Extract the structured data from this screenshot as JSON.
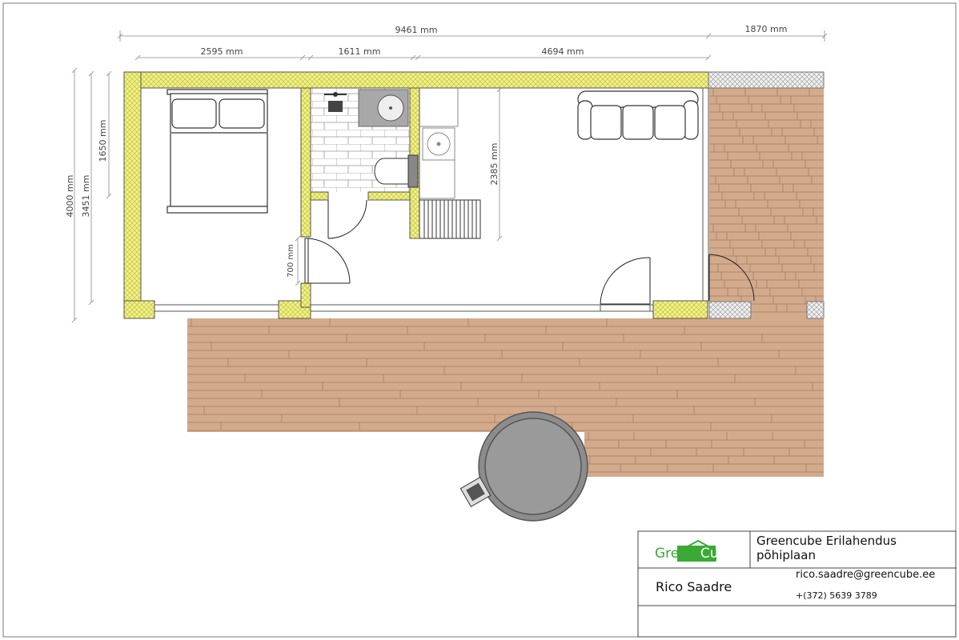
{
  "dimensions": {
    "total_width": "9461 mm",
    "terrace_width": "1870 mm",
    "bedroom_width": "2595 mm",
    "bath_width": "1611 mm",
    "living_width": "4694 mm",
    "total_depth": "4000 mm",
    "inner_depth": "3451 mm",
    "bath_depth": "1650 mm",
    "living_depth": "2385 mm",
    "door_width": "700 mm"
  },
  "title_block": {
    "logo_green": "Green",
    "logo_cube": "Cube",
    "project_line1": "Greencube Erilahendus",
    "project_line2": "põhiplaan",
    "author": "Rico Saadre",
    "email": "rico.saadre@greencube.ee",
    "phone": "+(372) 5639 3789"
  },
  "colors": {
    "wall_fill": "#f2f28a",
    "wall_hatch": "#c8c84a",
    "deck": "#d4aa8c",
    "deck_line": "#9e7a62",
    "tub_outer": "#8c8c8c",
    "tub_inner": "#9a9a9a",
    "logo_green": "#3aaa35"
  }
}
